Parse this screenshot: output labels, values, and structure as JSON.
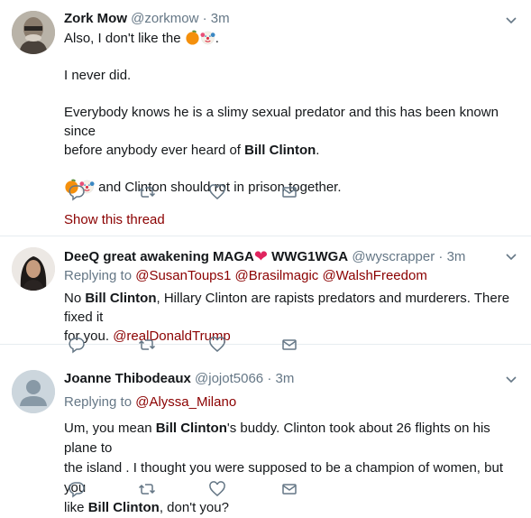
{
  "tweets": [
    {
      "name": "Zork Mow",
      "handle": "@zorkmow",
      "dot": "·",
      "time": "3m",
      "line1_text": "Also, I don't like the ",
      "line2": "I never did.",
      "line3_a": "Everybody knows he is a slimy sexual predator and this has been known since",
      "line3_b": "before anybody ever heard of ",
      "line3_bold": "Bill Clinton",
      "line3_end": ".",
      "line4_text": " and Clinton should rot in prison together.",
      "line1_end": ".",
      "show_thread": "Show this thread"
    },
    {
      "name_a": "DeeQ great awakening MAGA",
      "name_b": " WWG1WGA",
      "handle": "@wyscrapper",
      "dot": "·",
      "time": "3m",
      "replying_label": "Replying to ",
      "replying": [
        "@SusanToups1",
        "@Brasilmagic",
        "@WalshFreedom"
      ],
      "body_a": "No ",
      "body_bold": "Bill Clinton",
      "body_b": ", Hillary Clinton are rapists predators and murderers. There fixed it",
      "body_c": "for you. ",
      "body_mention": "@realDonaldTrump"
    },
    {
      "name": "Joanne Thibodeaux",
      "handle": "@jojot5066",
      "dot": "·",
      "time": "3m",
      "replying_label": "Replying to ",
      "replying": [
        "@Alyssa_Milano"
      ],
      "l1_a": "Um, you mean ",
      "l1_bold": "Bill Clinton",
      "l1_b": "'s buddy.  Clinton took about 26 flights on his plane to",
      "l2": "the island .  I thought you were supposed to be a champion of women, but you",
      "l3_a": "like ",
      "l3_bold": "Bill Clinton",
      "l3_b": ", don't you?"
    }
  ],
  "icons": {
    "reply": "reply-icon",
    "retweet": "retweet-icon",
    "like": "heart-icon",
    "dm": "envelope-icon",
    "more": "chevron-down-icon"
  },
  "colors": {
    "link": "#8b0000",
    "muted": "#657786",
    "heart": "#e0245e",
    "border": "#e6ecf0"
  }
}
